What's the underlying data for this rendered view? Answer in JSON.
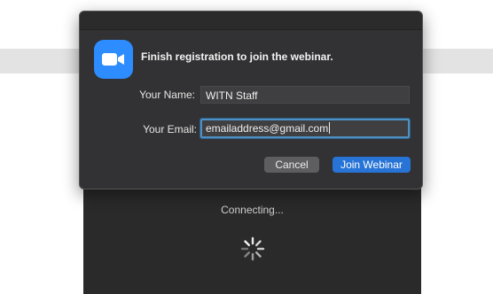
{
  "dialog": {
    "heading": "Finish registration to join the webinar.",
    "app_icon": "zoom-video-camera-icon",
    "name_label": "Your Name:",
    "name_value": "WITN Staff",
    "email_label": "Your Email:",
    "email_value": "emailaddress@gmail.com",
    "cancel_label": "Cancel",
    "join_label": "Join Webinar"
  },
  "background_window": {
    "status_text": "Connecting...",
    "spinner_icon": "loading-spinner-icon"
  },
  "colors": {
    "dialog_bg": "#323234",
    "accent_blue": "#2773d6",
    "zoom_blue": "#2d8cff",
    "focus_ring": "#4d90c4"
  }
}
